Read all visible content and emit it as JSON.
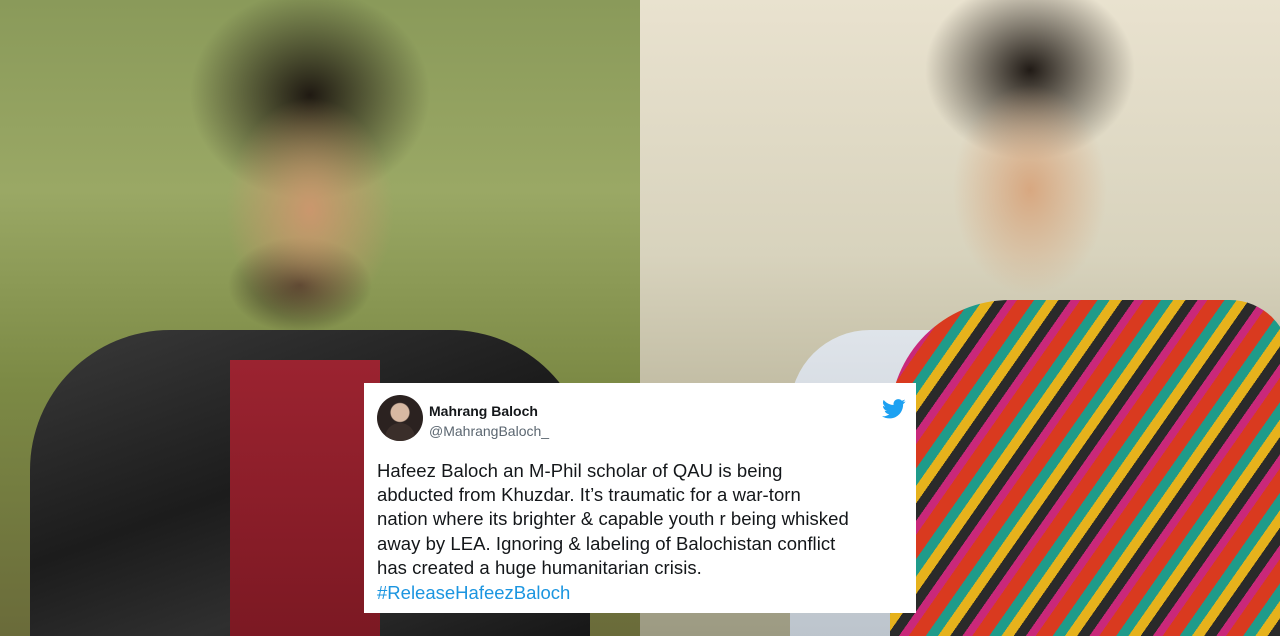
{
  "tweet": {
    "display_name": "Mahrang Baloch",
    "handle": "@MahrangBaloch_",
    "text_lines": [
      "Hafeez Baloch an M-Phil scholar of QAU is being",
      "abducted from Khuzdar. It’s traumatic for a war-torn",
      "nation where its brighter & capable youth r being whisked",
      "away by LEA. Ignoring & labeling of Balochistan conflict",
      "has created a huge humanitarian crisis."
    ],
    "hashtag": "#ReleaseHafeezBaloch",
    "icon": "twitter-bird-icon",
    "colors": {
      "hashtag": "#1b95e0",
      "bird": "#1da1f2",
      "text": "#14171a",
      "handle": "#5b6670"
    }
  }
}
